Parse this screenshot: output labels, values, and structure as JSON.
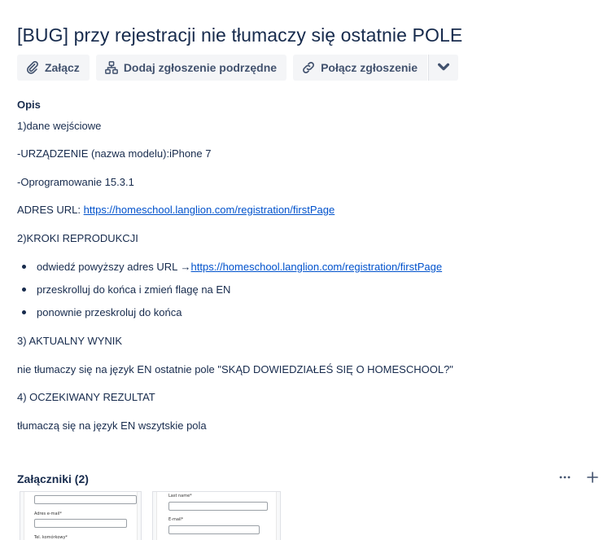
{
  "issue": {
    "title": "[BUG] przy rejestracji nie tłumaczy się ostatnie POLE"
  },
  "toolbar": {
    "attach_label": "Załącz",
    "attach_icon": "paperclip-icon",
    "child_issue_label": "Dodaj zgłoszenie podrzędne",
    "child_issue_icon": "hierarchy-icon",
    "link_issue_label": "Połącz zgłoszenie",
    "link_issue_icon": "link-icon",
    "more_icon": "chevron-down-icon"
  },
  "description": {
    "label": "Opis",
    "p1": "1)dane wejściowe",
    "p2": "-URZĄDZENIE (nazwa modelu):iPhone 7",
    "p3": "-Oprogramowanie 15.3.1",
    "p4_prefix": "ADRES URL: ",
    "p4_link": "https://homeschool.langlion.com/registration/firstPage",
    "p5": "2)KROKI REPRODUKCJI",
    "steps": [
      {
        "text": "odwiedź powyższy adres URL → ",
        "link": "https://homeschool.langlion.com/registration/firstPage"
      },
      {
        "text": "przeskrolluj do końca i zmień flagę na EN",
        "link": ""
      },
      {
        "text": "ponownie przeskroluj do końca",
        "link": ""
      }
    ],
    "p6": "3) AKTUALNY WYNIK",
    "p7": "nie tłumaczy się na język EN ostatnie pole \"SKĄD DOWIEDZIAŁEŚ SIĘ O HOMESCHOOL?\"",
    "p8": "4) OCZEKIWANY REZULTAT",
    "p9": "tłumaczą się na język EN wszytskie pola"
  },
  "attachments": {
    "label": "Załączniki (2)",
    "more_icon": "ellipsis-icon",
    "add_icon": "plus-icon",
    "thumb1": {
      "email_label": "Adres e-mail*",
      "phone_label": "Tel. komórkowy*"
    },
    "thumb2": {
      "lastname_label": "Last name*",
      "email_label": "E-mail*"
    }
  }
}
